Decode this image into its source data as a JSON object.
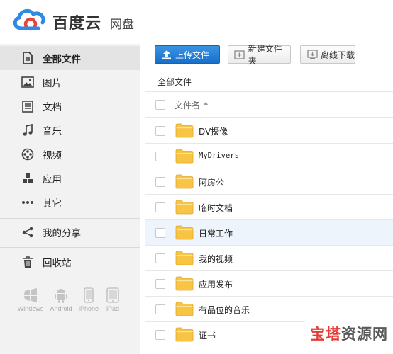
{
  "header": {
    "brand": "百度云",
    "brand_sub": "网盘"
  },
  "sidebar": {
    "items": [
      {
        "label": "全部文件",
        "icon": "all-files-icon",
        "active": true
      },
      {
        "label": "图片",
        "icon": "image-icon"
      },
      {
        "label": "文档",
        "icon": "document-icon"
      },
      {
        "label": "音乐",
        "icon": "music-icon"
      },
      {
        "label": "视频",
        "icon": "video-icon"
      },
      {
        "label": "应用",
        "icon": "app-icon"
      },
      {
        "label": "其它",
        "icon": "more-icon"
      },
      {
        "label": "我的分享",
        "icon": "share-icon"
      },
      {
        "label": "回收站",
        "icon": "trash-icon"
      }
    ],
    "clients": [
      {
        "label": "Windows",
        "icon": "windows-icon"
      },
      {
        "label": "Android",
        "icon": "android-icon"
      },
      {
        "label": "iPhone",
        "icon": "iphone-icon"
      },
      {
        "label": "iPad",
        "icon": "ipad-icon"
      }
    ]
  },
  "toolbar": {
    "upload": "上传文件",
    "new_folder": "新建文件夹",
    "offline": "离线下载"
  },
  "breadcrumb": "全部文件",
  "list": {
    "column_name": "文件名",
    "rows": [
      {
        "name": "DV摄像"
      },
      {
        "name": "MyDrivers"
      },
      {
        "name": "阿房公"
      },
      {
        "name": "临时文档"
      },
      {
        "name": "日常工作"
      },
      {
        "name": "我的视频"
      },
      {
        "name": "应用发布"
      },
      {
        "name": "有品位的音乐"
      },
      {
        "name": "证书"
      }
    ]
  },
  "watermark": {
    "part1": "宝塔",
    "part2": "资源网"
  },
  "colors": {
    "accent": "#1f7ad6",
    "folder": "#f7c443",
    "sidebar_bg": "#f2f2f2",
    "watermark_red": "#e53b35"
  }
}
